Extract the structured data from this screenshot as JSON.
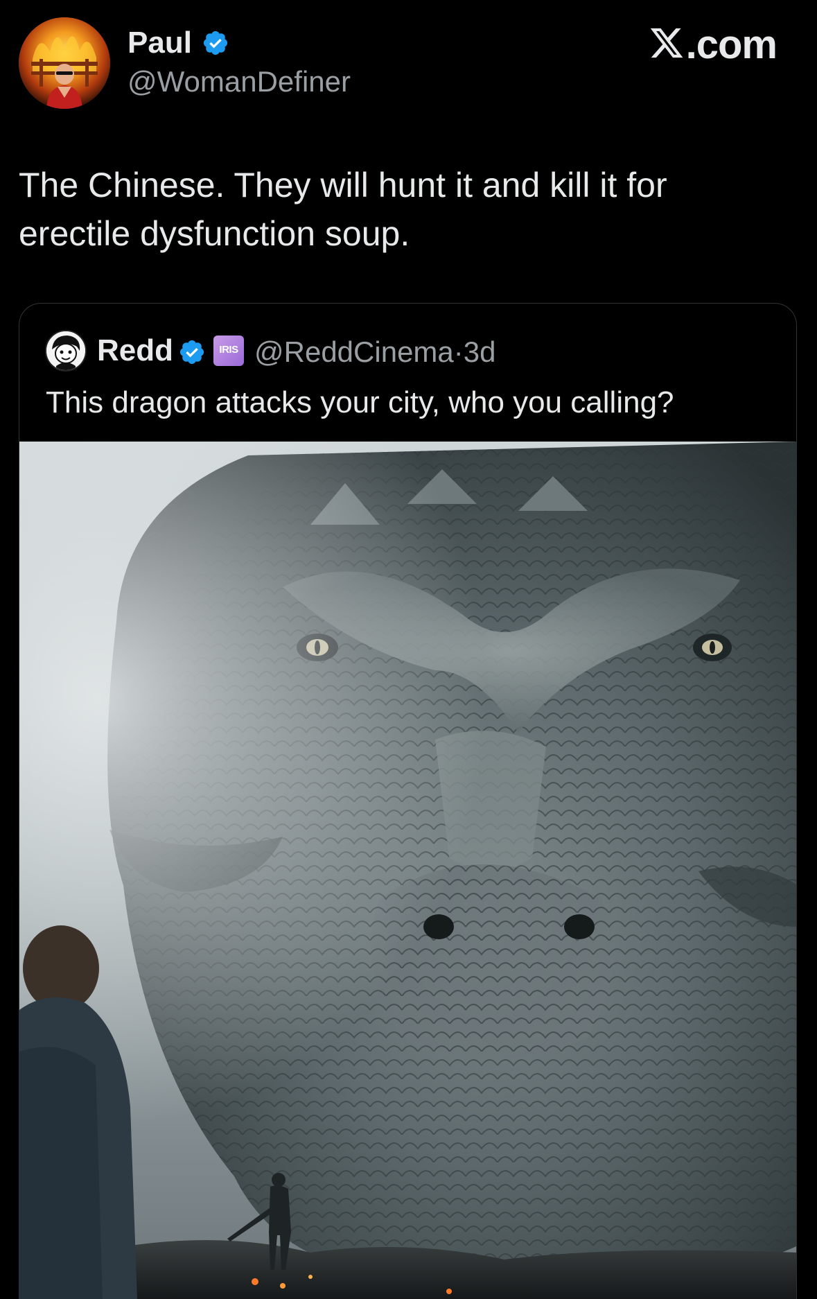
{
  "tweet": {
    "author": {
      "display_name": "Paul",
      "handle": "@WomanDefiner",
      "verified": true,
      "avatar_icon": "avatar-burning-cartoon"
    },
    "brand": {
      "name": ".com",
      "logo_icon": "x-logo-icon"
    },
    "text": "The Chinese. They will hunt it and kill it for erectile dysfunction soup."
  },
  "quoted_tweet": {
    "author": {
      "display_name": "Redd",
      "handle": "@ReddCinema",
      "verified": true,
      "affiliate_badge_text": "IRIS",
      "avatar_icon": "avatar-cartoon-face"
    },
    "separator": "·",
    "age": "3d",
    "text": "This dragon attacks your city, who you calling?",
    "media": {
      "icon": "dragon-image"
    }
  },
  "colors": {
    "background": "#000000",
    "text_primary": "#e7e9ea",
    "text_secondary": "#9a9fa4",
    "verified_blue": "#1d9bf0",
    "card_border": "#2f3336"
  }
}
